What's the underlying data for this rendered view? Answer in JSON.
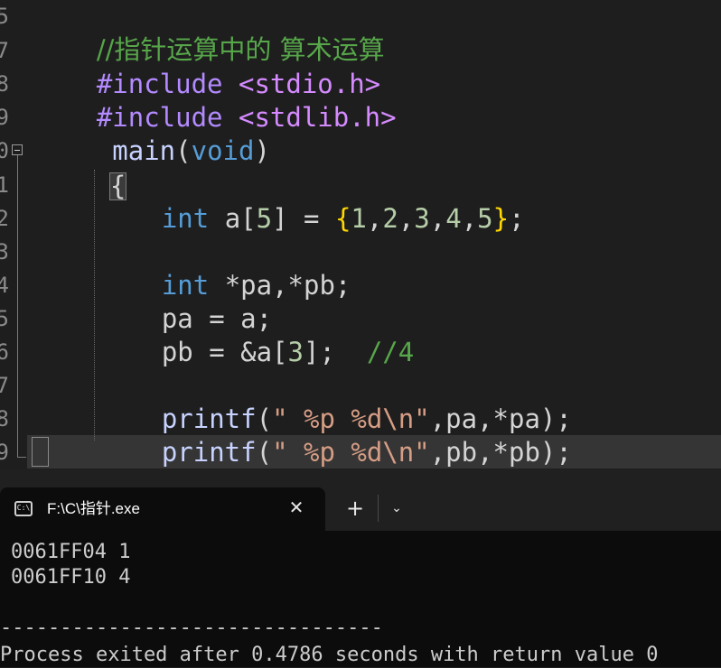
{
  "editor": {
    "line_numbers": [
      "5",
      "7",
      "8",
      "9",
      "0",
      "1",
      "2",
      "3",
      "4",
      "5",
      "6",
      "7",
      "8",
      "9"
    ],
    "lines": {
      "l1": {
        "comment": "//指针运算中的 算术运算"
      },
      "l2": {
        "pre": "#include",
        "inc": " <stdio.h>"
      },
      "l3": {
        "pre": "#include",
        "inc": " <stdlib.h>"
      },
      "l4": {
        "fn": " main",
        "p1": "(",
        "kw": "void",
        "p2": ")"
      },
      "l5": {
        "brace": "{"
      },
      "l6": {
        "kw": "int",
        "a": " a[",
        "n5": "5",
        "b": "] = ",
        "ob": "{",
        "n1": "1",
        "c1": ",",
        "n2": "2",
        "c2": ",",
        "n3": "3",
        "c3": ",",
        "n4": "4",
        "c4": ",",
        "n5b": "5",
        "cb": "}",
        "semi": ";"
      },
      "l8": {
        "kw": "int",
        "rest": " *pa,*pb;"
      },
      "l9": {
        "text": "pa = a;"
      },
      "l10": {
        "a": "pb = &a[",
        "n": "3",
        "b": "];  ",
        "comment": "//4"
      },
      "l12": {
        "fn": "printf",
        "p": "(",
        "str": "\" %p %d\\n\"",
        "rest": ",pa,*pa);"
      },
      "l13": {
        "fn": "printf",
        "p": "(",
        "str": "\" %p %d\\n\"",
        "rest": ",pb,*pb);"
      },
      "l14": {
        "brace": "}"
      }
    }
  },
  "terminal": {
    "tab_icon": "C:\\",
    "tab_title": "F:\\C\\指针.exe",
    "close_glyph": "✕",
    "new_tab_glyph": "+",
    "dropdown_glyph": "⌄",
    "output": [
      "0061FF04 1",
      "0061FF10 4",
      "",
      "--------------------------------",
      "Process exited after 0.4786 seconds with return value 0"
    ]
  },
  "colors": {
    "editor_bg": "#1e1e1e",
    "terminal_bg": "#0c0c0c",
    "keyword": "#569cd6",
    "comment": "#57a64a",
    "string": "#d69d85"
  }
}
